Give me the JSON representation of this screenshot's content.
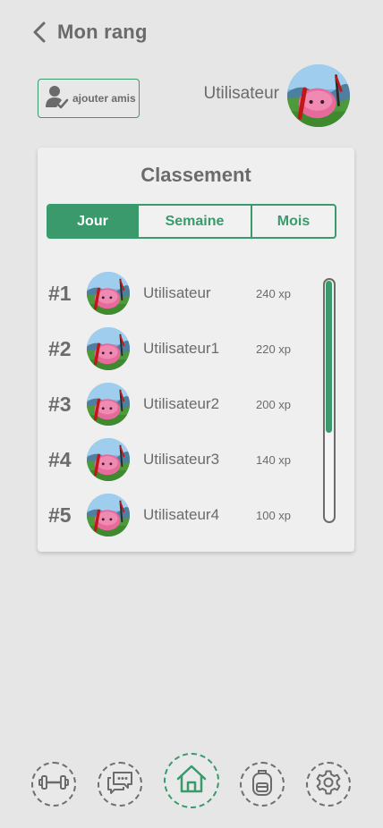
{
  "header": {
    "title": "Mon rang",
    "back_icon": "chevron-left-icon"
  },
  "profile": {
    "add_friend_label": "ajouter amis",
    "add_friend_icon": "user-check-icon",
    "username": "Utilisateur"
  },
  "leaderboard": {
    "title": "Classement",
    "tabs": [
      {
        "label": "Jour",
        "active": true
      },
      {
        "label": "Semaine",
        "active": false
      },
      {
        "label": "Mois",
        "active": false
      }
    ],
    "rows": [
      {
        "rank": "#1",
        "name": "Utilisateur",
        "xp": "240 xp"
      },
      {
        "rank": "#2",
        "name": "Utilisateur1",
        "xp": "220 xp"
      },
      {
        "rank": "#3",
        "name": "Utilisateur2",
        "xp": "200 xp"
      },
      {
        "rank": "#4",
        "name": "Utilisateur3",
        "xp": "140 xp"
      },
      {
        "rank": "#5",
        "name": "Utilisateur4",
        "xp": "100 xp"
      }
    ]
  },
  "bottom_nav": [
    {
      "icon": "dumbbell-icon",
      "active": false
    },
    {
      "icon": "chat-icon",
      "active": false
    },
    {
      "icon": "home-icon",
      "active": true
    },
    {
      "icon": "backpack-icon",
      "active": false
    },
    {
      "icon": "gear-icon",
      "active": false
    }
  ],
  "colors": {
    "accent": "#3a9a6b",
    "text": "#6b6b6b",
    "background": "#e6e6e6",
    "card": "#efefef"
  }
}
